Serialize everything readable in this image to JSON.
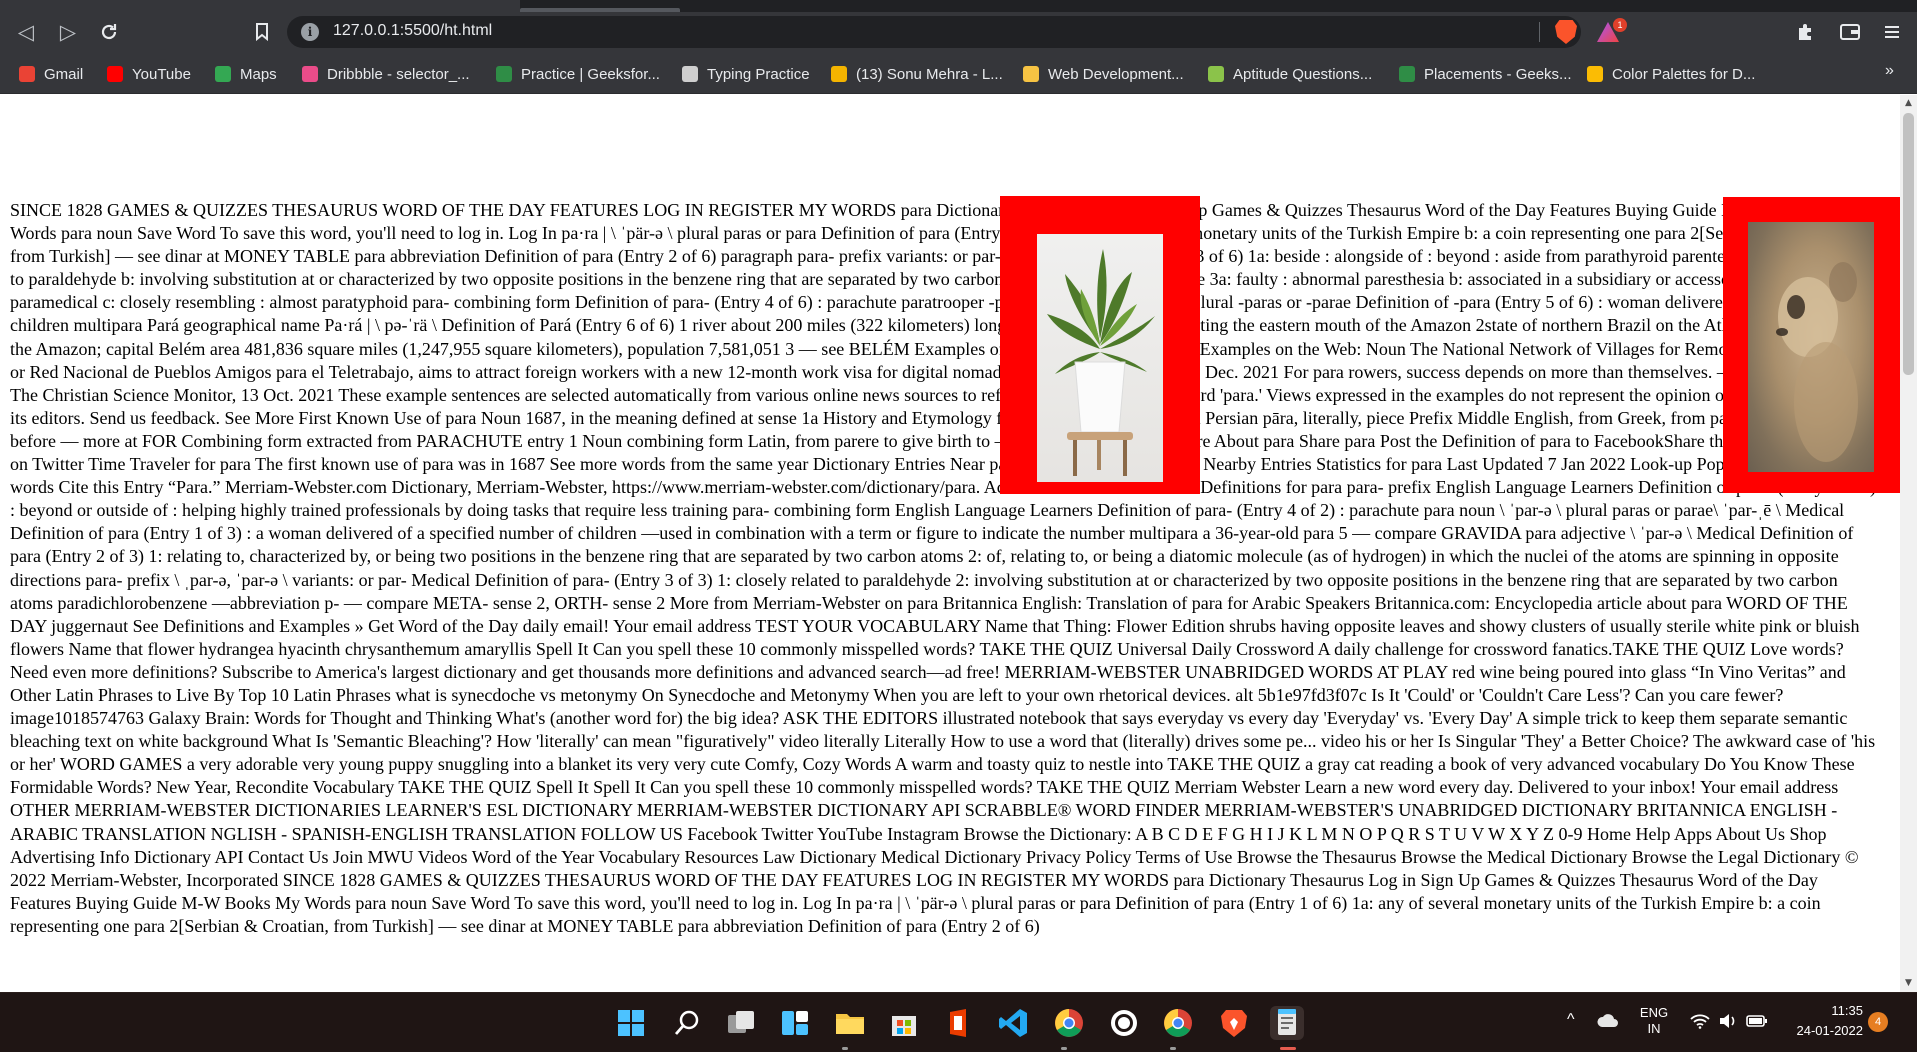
{
  "browser": {
    "url": "127.0.0.1:5500/ht.html",
    "rewards_badge": "1",
    "bookmarks": [
      {
        "label": "Gmail",
        "icon": "gmail-icon",
        "color": "#ea4335"
      },
      {
        "label": "YouTube",
        "icon": "youtube-icon",
        "color": "#ff0000"
      },
      {
        "label": "Maps",
        "icon": "maps-icon",
        "color": "#34a853"
      },
      {
        "label": "Dribbble - selector_...",
        "icon": "dribbble-icon",
        "color": "#ea4c89"
      },
      {
        "label": "Practice | Geeksfor...",
        "icon": "geeksforgeeks-icon",
        "color": "#2f8d46"
      },
      {
        "label": "Typing Practice",
        "icon": "typing-icon",
        "color": "#cfcfcf"
      },
      {
        "label": "(13) Sonu Mehra - L...",
        "icon": "linkedin-icon",
        "color": "#f4b400"
      },
      {
        "label": "Web Development...",
        "icon": "web-dev-icon",
        "color": "#f6c343"
      },
      {
        "label": "Aptitude Questions...",
        "icon": "aptitude-icon",
        "color": "#8bc34a"
      },
      {
        "label": "Placements - Geeks...",
        "icon": "geeksforgeeks-icon",
        "color": "#2f8d46"
      },
      {
        "label": "Color Palettes for D...",
        "icon": "color-palettes-icon",
        "color": "#fbbc04"
      }
    ],
    "bookmarks_overflow": "»"
  },
  "page": {
    "text": "SINCE 1828 GAMES & QUIZZES THESAURUS WORD OF THE DAY FEATURES LOG IN REGISTER MY WORDS para Dictionary Thesaurus Log in Sign Up Games & Quizzes Thesaurus Word of the Day Features Buying Guide M-W Books My Words para noun Save Word To save this word, you'll need to log in. Log In pa·ra | \\ ˈpär-ə \\ plural paras or para Definition of para (Entry 1 of 6) 1a: any of several monetary units of the Turkish Empire b: a coin representing one para 2[Serbian & Croatian, from Turkish] — see dinar at MONEY TABLE para abbreviation Definition of para (Entry 2 of 6) paragraph para- prefix variants: or par- Definition of para- (Entry 3 of 6) 1a: beside : alongside of : beyond : aside from parathyroid parenteral 2a: closely related to paraldehyde b: involving substitution at or characterized by two opposite positions in the benzene ring that are separated by two carbon atoms paradichlorobenzene 3a: faulty : abnormal paresthesia b: associated in a subsidiary or accessory capacity paramedical c: closely resembling : almost paratyphoid para- combining form Definition of para- (Entry 4 of 6) : parachute paratrooper -para noun combining form plural -paras or -parae Definition of -para (Entry 5 of 6) : woman delivered of (so many) children multipara Pará geographical name Pa·rá | \\ pə-ˈrä \\ Definition of Pará (Entry 6 of 6) 1 river about 200 miles (322 kilometers) long in northern Brazil constituting the eastern mouth of the Amazon 2state of northern Brazil on the Atlantic bordering on the Amazon; capital Belém area 481,836 square miles (1,247,955 square kilometers), population 7,581,051 3 — see BELÉM Examples of para in a Sentence Recent Examples on the Web: Noun The National Network of Villages for Remote Workers scheme, or Red Nacional de Pueblos Amigos para el Teletrabajo, aims to attract foreign workers with a new 12-month work visa for digital nomads. — Jack Kelly, Forbes, 28 Dec. 2021 For para rowers, success depends on more than themselves. — Bethany Garnett, The Christian Science Monitor, 13 Oct. 2021 These example sentences are selected automatically from various online news sources to reflect current usage of the word 'para.' Views expressed in the examples do not represent the opinion of Merriam-Webster or its editors. Send us feedback. See More First Known Use of para Noun 1687, in the meaning defined at sense 1a History and Etymology for para Noun Turkish, from Persian pāra, literally, piece Prefix Middle English, from Greek, from para; akin to Greek pro before — more at FOR Combining form extracted from PARACHUTE entry 1 Noun combining form Latin, from parere to give birth to — more at PARE Learn More About para Share para Post the Definition of para to FacebookShare the Definition of para on Twitter Time Traveler for para The first known use of para was in 1687 See more words from the same year Dictionary Entries Near para par para para- See More Nearby Entries Statistics for para Last Updated 7 Jan 2022 Look-up Popularity Top 1% of words Cite this Entry “Para.” Merriam-Webster.com Dictionary, Merriam-Webster, https://www.merriam-webster.com/dictionary/para. Accessed 23 Jan. 2022. More Definitions for para para- prefix English Language Learners Definition of para- (Entry 3 of 2) : beyond or outside of : helping highly trained professionals by doing tasks that require less training para- combining form English Language Learners Definition of para- (Entry 4 of 2) : parachute para noun \\ ˈpar-ə \\ plural paras or parae\\ ˈpar-ˌē \\ Medical Definition of para (Entry 1 of 3) : a woman delivered of a specified number of children —used in combination with a term or figure to indicate the number multipara a 36-year-old para 5 — compare GRAVIDA para adjective \\ ˈpar-ə \\ Medical Definition of para (Entry 2 of 3) 1: relating to, characterized by, or being two positions in the benzene ring that are separated by two carbon atoms 2: of, relating to, or being a diatomic molecule (as of hydrogen) in which the nuclei of the atoms are spinning in opposite directions para- prefix \\ ˌpar-ə, ˈpar-ə \\ variants: or par- Medical Definition of para- (Entry 3 of 3) 1: closely related to paraldehyde 2: involving substitution at or characterized by two opposite positions in the benzene ring that are separated by two carbon atoms paradichlorobenzene —abbreviation p- — compare META- sense 2, ORTH- sense 2 More from Merriam-Webster on para Britannica English: Translation of para for Arabic Speakers Britannica.com: Encyclopedia article about para WORD OF THE DAY juggernaut See Definitions and Examples » Get Word of the Day daily email! Your email address TEST YOUR VOCABULARY Name that Thing: Flower Edition shrubs having opposite leaves and showy clusters of usually sterile white pink or bluish flowers Name that flower hydrangea hyacinth chrysanthemum amaryllis Spell It Can you spell these 10 commonly misspelled words? TAKE THE QUIZ Universal Daily Crossword A daily challenge for crossword fanatics.TAKE THE QUIZ Love words? Need even more definitions? Subscribe to America's largest dictionary and get thousands more definitions and advanced search—ad free! MERRIAM-WEBSTER UNABRIDGED WORDS AT PLAY red wine being poured into glass “In Vino Veritas” and Other Latin Phrases to Live By Top 10 Latin Phrases what is synecdoche vs metonymy On Synecdoche and Metonymy When you are left to your own rhetorical devices. alt 5b1e97fd3f07c Is It 'Could' or 'Couldn't Care Less'? Can you care fewer? image1018574763 Galaxy Brain: Words for Thought and Thinking What's (another word for) the big idea? ASK THE EDITORS illustrated notebook that says everyday vs every day 'Everyday' vs. 'Every Day' A simple trick to keep them separate semantic bleaching text on white background What Is 'Semantic Bleaching'? How 'literally' can mean \"figuratively\" video literally Literally How to use a word that (literally) drives some pe... video his or her Is Singular 'They' a Better Choice? The awkward case of 'his or her' WORD GAMES a very adorable very young puppy snuggling into a blanket its very very cute Comfy, Cozy Words A warm and toasty quiz to nestle into TAKE THE QUIZ a gray cat reading a book of very advanced vocabulary Do You Know These Formidable Words? New Year, Recondite Vocabulary TAKE THE QUIZ Spell It Spell It Can you spell these 10 commonly misspelled words? TAKE THE QUIZ Merriam Webster Learn a new word every day. Delivered to your inbox! Your email address OTHER MERRIAM-WEBSTER DICTIONARIES LEARNER'S ESL DICTIONARY MERRIAM-WEBSTER DICTIONARY API SCRABBLE® WORD FINDER MERRIAM-WEBSTER'S UNABRIDGED DICTIONARY BRITANNICA ENGLISH - ARABIC TRANSLATION NGLISH - SPANISH-ENGLISH TRANSLATION FOLLOW US Facebook Twitter YouTube Instagram Browse the Dictionary: A B C D E F G H I J K L M N O P Q R S T U V W X Y Z 0-9 Home Help Apps About Us Shop Advertising Info Dictionary API Contact Us Join MWU Videos Word of the Year Vocabulary Resources Law Dictionary Medical Dictionary Privacy Policy Terms of Use Browse the Thesaurus Browse the Medical Dictionary Browse the Legal Dictionary © 2022 Merriam-Webster, Incorporated SINCE 1828 GAMES & QUIZZES THESAURUS WORD OF THE DAY FEATURES LOG IN REGISTER MY WORDS para Dictionary Thesaurus Log in Sign Up Games & Quizzes Thesaurus Word of the Day Features Buying Guide M-W Books My Words para noun Save Word To save this word, you'll need to log in. Log In pa·ra | \\ ˈpär-ə \\ plural paras or para Definition of para (Entry 1 of 6) 1a: any of several monetary units of the Turkish Empire b: a coin representing one para 2[Serbian & Croatian, from Turkish] — see dinar at MONEY TABLE para abbreviation Definition of para (Entry 2 of 6)",
    "image_border_color": "#ff0000",
    "images": [
      {
        "subject": "potted-plant-image"
      },
      {
        "subject": "meerkat-image"
      }
    ]
  },
  "taskbar": {
    "apps": [
      "windows-start-icon",
      "search-icon",
      "task-view-icon",
      "widgets-icon",
      "file-explorer-icon",
      "microsoft-store-icon",
      "office-icon",
      "vscode-icon",
      "chrome-icon",
      "whatsapp-icon",
      "chrome-icon",
      "brave-icon",
      "notepad-icon"
    ],
    "lang_line1": "ENG",
    "lang_line2": "IN",
    "time": "11:35",
    "date": "24-01-2022",
    "notifications": "4"
  }
}
